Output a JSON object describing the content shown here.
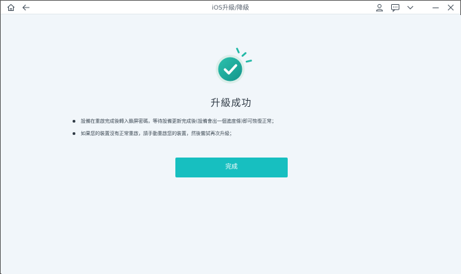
{
  "window": {
    "title": "iOS升級/降級"
  },
  "toolbar": {
    "home_icon": "home-icon",
    "back_icon": "back-arrow-icon",
    "account_icon": "user-icon",
    "feedback_icon": "feedback-icon",
    "menu_icon": "chevron-down-icon",
    "minimize_icon": "minimize-icon",
    "close_icon": "close-icon"
  },
  "main": {
    "status_icon": "check-circle-icon",
    "heading": "升級成功",
    "notes": [
      "設備在重啟完成後轉入鎖屏密碼，等待設備更新完成後(設備會出一個進度條)即可恢復正常；",
      "如果您的裝置沒有正常重啟，請手動重啟您的裝置，然後嘗試再次升級；"
    ],
    "done_button": "完成"
  },
  "colors": {
    "accent": "#17bfc0",
    "check_circle": "#1fae9f",
    "background": "#f1f6fa"
  }
}
